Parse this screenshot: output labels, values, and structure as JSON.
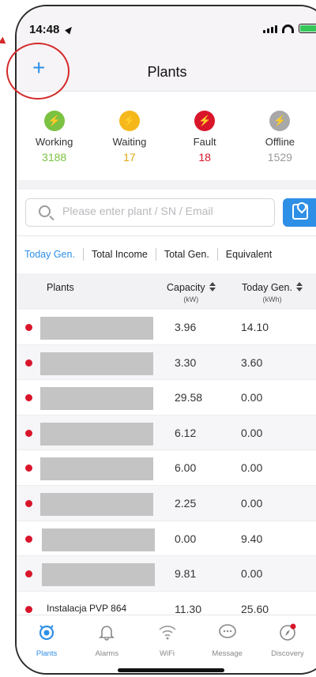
{
  "status_bar": {
    "time": "14:48"
  },
  "nav": {
    "title": "Plants",
    "add_symbol": "+"
  },
  "summary": [
    {
      "label": "Working",
      "count": "3188",
      "color": "#7cc242",
      "num_color": "#7cc242",
      "icon": "bolt-icon"
    },
    {
      "label": "Waiting",
      "count": "17",
      "color": "#f5b81c",
      "num_color": "#e0a814",
      "icon": "bolt-icon"
    },
    {
      "label": "Fault",
      "count": "18",
      "color": "#d9152a",
      "num_color": "#d9152a",
      "icon": "bolt-icon"
    },
    {
      "label": "Offline",
      "count": "1529",
      "color": "#a8a8a8",
      "num_color": "#999999",
      "icon": "bolt-icon"
    }
  ],
  "search": {
    "placeholder": "Please enter plant / SN / Email"
  },
  "tabs": [
    "Today Gen.",
    "Total Income",
    "Total Gen.",
    "Equivalent"
  ],
  "table": {
    "headers": {
      "plants": "Plants",
      "capacity": "Capacity",
      "capacity_unit": "(kW)",
      "today_gen": "Today Gen.",
      "today_gen_unit": "(kWh)"
    },
    "rows": [
      {
        "name": "",
        "capacity": "3.96",
        "today_gen": "14.10"
      },
      {
        "name": "",
        "capacity": "3.30",
        "today_gen": "3.60"
      },
      {
        "name": "",
        "capacity": "29.58",
        "today_gen": "0.00"
      },
      {
        "name": "",
        "capacity": "6.12",
        "today_gen": "0.00"
      },
      {
        "name": "",
        "capacity": "6.00",
        "today_gen": "0.00"
      },
      {
        "name": "",
        "capacity": "2.25",
        "today_gen": "0.00"
      },
      {
        "name": "",
        "capacity": "0.00",
        "today_gen": "9.40"
      },
      {
        "name": "",
        "capacity": "9.81",
        "today_gen": "0.00"
      },
      {
        "name": "Instalacja PVP 864",
        "capacity": "11.30",
        "today_gen": "25.60"
      }
    ]
  },
  "tabbar": [
    {
      "label": "Plants",
      "icon": "plant-icon"
    },
    {
      "label": "Alarms",
      "icon": "bell-icon"
    },
    {
      "label": "WiFi",
      "icon": "wifi-icon"
    },
    {
      "label": "Message",
      "icon": "message-icon"
    },
    {
      "label": "Discovery",
      "icon": "compass-icon"
    }
  ],
  "colors": {
    "accent": "#2e8fe6",
    "fault": "#d9152a"
  }
}
